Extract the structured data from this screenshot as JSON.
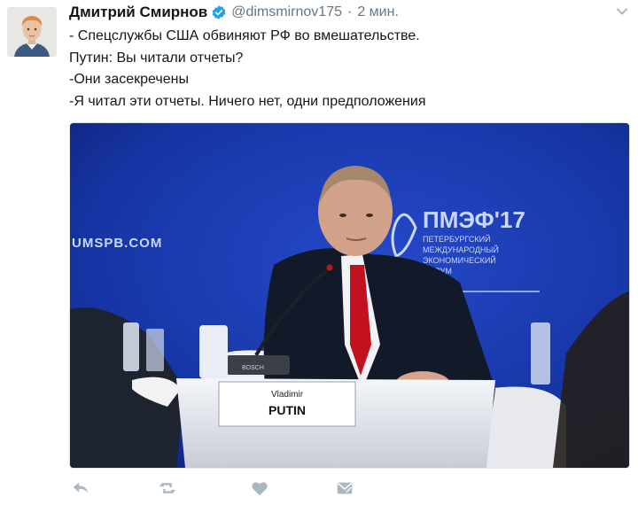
{
  "tweet": {
    "author_name": "Дмитрий Смирнов",
    "handle": "@dimsmirnov175",
    "separator": "·",
    "time": "2 мин.",
    "lines": [
      "- Спецслужбы США обвиняют РФ во вмешательстве.",
      "Путин: Вы читали отчеты?",
      "-Они засекречены",
      "-Я читал эти отчеты. Ничего нет, одни предположения"
    ]
  },
  "media": {
    "backdrop_site": "UMSPB.COM",
    "backdrop_logo": "ПМЭФ'17",
    "backdrop_lines": [
      "ПЕТЕРБУРГСКИЙ",
      "МЕЖДУНАРОДНЫЙ",
      "ЭКОНОМИЧЕСКИЙ",
      "ФОРУМ"
    ],
    "nameplate_first": "Vladimir",
    "nameplate_last": "PUTIN",
    "mic_brand": "BOSCH"
  },
  "colors": {
    "accent": "#1da1f2",
    "text": "#14171a",
    "muted": "#657786",
    "action_icon": "#aab8c2",
    "stage_blue": "#1634a3"
  },
  "icons": [
    "verified-icon",
    "caret-down-icon",
    "reply-icon",
    "retweet-icon",
    "like-icon",
    "direct-message-icon"
  ]
}
